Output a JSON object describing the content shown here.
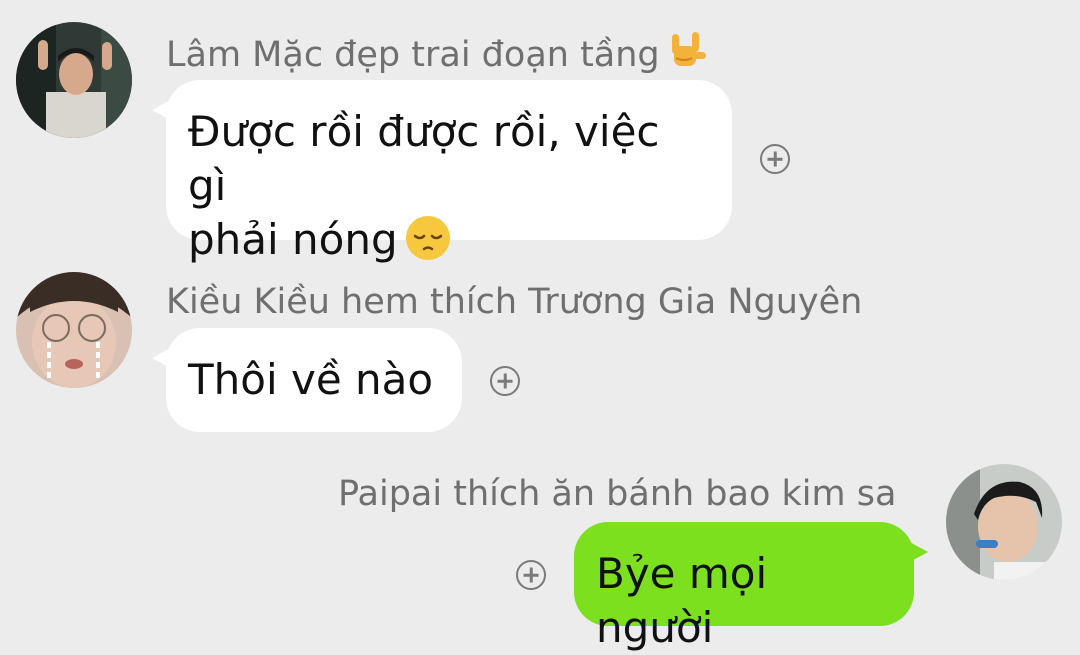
{
  "messages": [
    {
      "sender": "Lâm Mặc đẹp trai đoạn tầng",
      "sender_emoji": "love-you-hand-emoji",
      "lines": [
        "Được rồi được rồi, việc gì",
        "phải nóng"
      ],
      "text_emoji": "pensive-face-emoji",
      "side": "left"
    },
    {
      "sender": "Kiều Kiều hem thích Trương Gia Nguyên",
      "lines": [
        "Thôi về nào"
      ],
      "side": "left"
    },
    {
      "sender": "Paipai thích ăn bánh bao kim sa",
      "lines": [
        "Bỷe mọi người"
      ],
      "side": "right"
    }
  ],
  "colors": {
    "background": "#ececec",
    "incoming_bubble": "#ffffff",
    "outgoing_bubble": "#7de01e",
    "sender_name": "#6f6f6f"
  },
  "icons": [
    "add-reaction-icon",
    "avatar"
  ]
}
